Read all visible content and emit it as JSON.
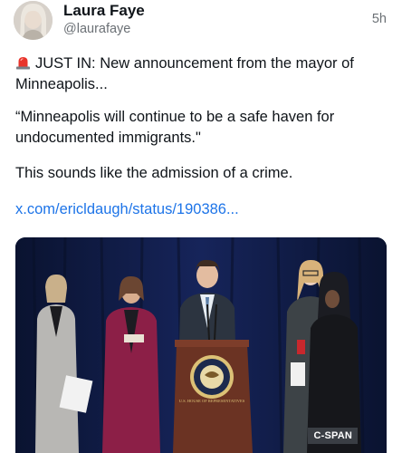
{
  "post": {
    "author_name": "Laura Faye",
    "author_handle": "@laurafaye",
    "timestamp": "5h",
    "text_line1": "JUST IN: New announcement from the mayor of Minneapolis...",
    "text_line2": "“Minneapolis will continue to be a safe haven for undocumented immigrants.\"",
    "text_line3": "This sounds like the admission of a crime.",
    "link": "x.com/ericldaugh/status/190386...",
    "lead_icon": "siren-icon",
    "media": {
      "description_icon": "video-thumbnail",
      "seal_text": "U.S. HOUSE OF REPRESENTATIVES",
      "network_badge": "C-SPAN"
    }
  },
  "colors": {
    "link": "#1d74e8",
    "secondary_text": "#6b7075",
    "media_background": "#0d1733"
  }
}
